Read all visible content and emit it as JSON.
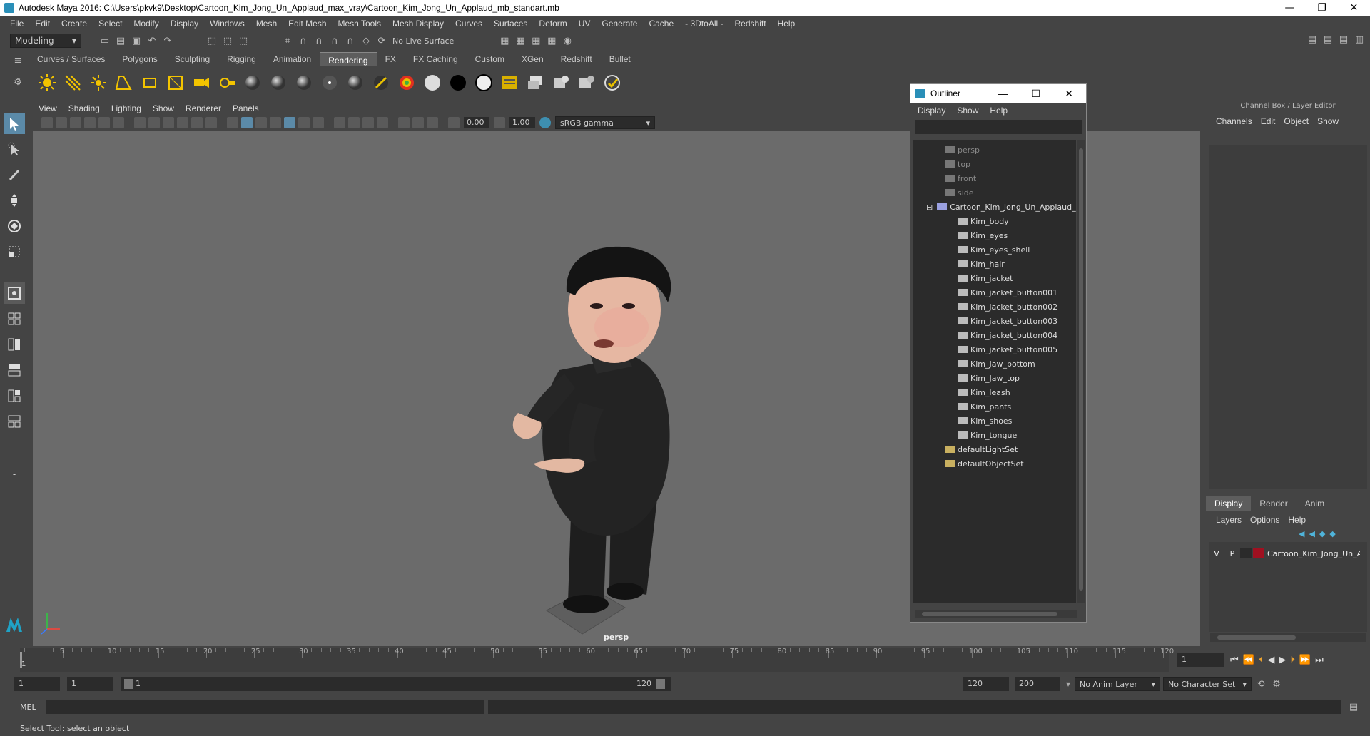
{
  "window": {
    "title": "Autodesk Maya 2016: C:\\Users\\pkvk9\\Desktop\\Cartoon_Kim_Jong_Un_Applaud_max_vray\\Cartoon_Kim_Jong_Un_Applaud_mb_standart.mb",
    "minimize": "—",
    "maximize": "❐",
    "close": "✕"
  },
  "menubar": [
    "File",
    "Edit",
    "Create",
    "Select",
    "Modify",
    "Display",
    "Windows",
    "Mesh",
    "Edit Mesh",
    "Mesh Tools",
    "Mesh Display",
    "Curves",
    "Surfaces",
    "Deform",
    "UV",
    "Generate",
    "Cache",
    "- 3DtoAll -",
    "Redshift",
    "Help"
  ],
  "statusline": {
    "mode": "Modeling",
    "live_surface": "No Live Surface"
  },
  "shelf": {
    "tabs": [
      "Curves / Surfaces",
      "Polygons",
      "Sculpting",
      "Rigging",
      "Animation",
      "Rendering",
      "FX",
      "FX Caching",
      "Custom",
      "XGen",
      "Redshift",
      "Bullet"
    ],
    "active": "Rendering"
  },
  "viewport": {
    "menu": [
      "View",
      "Shading",
      "Lighting",
      "Show",
      "Renderer",
      "Panels"
    ],
    "exposure": "0.00",
    "gamma": "1.00",
    "colorspace": "sRGB gamma",
    "camera_label": "persp"
  },
  "outliner": {
    "title": "Outliner",
    "menu": [
      "Display",
      "Show",
      "Help"
    ],
    "cameras": [
      "persp",
      "top",
      "front",
      "side"
    ],
    "group": "Cartoon_Kim_Jong_Un_Applaud_",
    "children": [
      "Kim_body",
      "Kim_eyes",
      "Kim_eyes_shell",
      "Kim_hair",
      "Kim_jacket",
      "Kim_jacket_button001",
      "Kim_jacket_button002",
      "Kim_jacket_button003",
      "Kim_jacket_button004",
      "Kim_jacket_button005",
      "Kim_Jaw_bottom",
      "Kim_Jaw_top",
      "Kim_leash",
      "Kim_pants",
      "Kim_shoes",
      "Kim_tongue"
    ],
    "sets": [
      "defaultLightSet",
      "defaultObjectSet"
    ]
  },
  "channelbox": {
    "header": "Channel Box / Layer Editor",
    "menu": [
      "Channels",
      "Edit",
      "Object",
      "Show"
    ],
    "layer_tabs": [
      "Display",
      "Render",
      "Anim"
    ],
    "layer_menu": [
      "Layers",
      "Options",
      "Help"
    ],
    "layer": {
      "v": "V",
      "p": "P",
      "name": "Cartoon_Kim_Jong_Un_A",
      "color": "#a01020"
    }
  },
  "timeslider": {
    "ticks": [
      "5",
      "10",
      "15",
      "20",
      "25",
      "30",
      "35",
      "40",
      "45",
      "50",
      "55",
      "60",
      "65",
      "70",
      "75",
      "80",
      "85",
      "90",
      "95",
      "100",
      "105",
      "110",
      "115",
      "120"
    ],
    "start_label": "1",
    "current_frame": "1"
  },
  "range": {
    "start": "1",
    "start2": "1",
    "range_start": "1",
    "range_end": "120",
    "end": "120",
    "max": "200",
    "anim_layer": "No Anim Layer",
    "char_set": "No Character Set"
  },
  "cmdline": {
    "label": "MEL"
  },
  "helpline": "Select Tool: select an object",
  "colors": {
    "accent": "#5d5d5d",
    "viewport_bg": "#6b6b6b"
  }
}
